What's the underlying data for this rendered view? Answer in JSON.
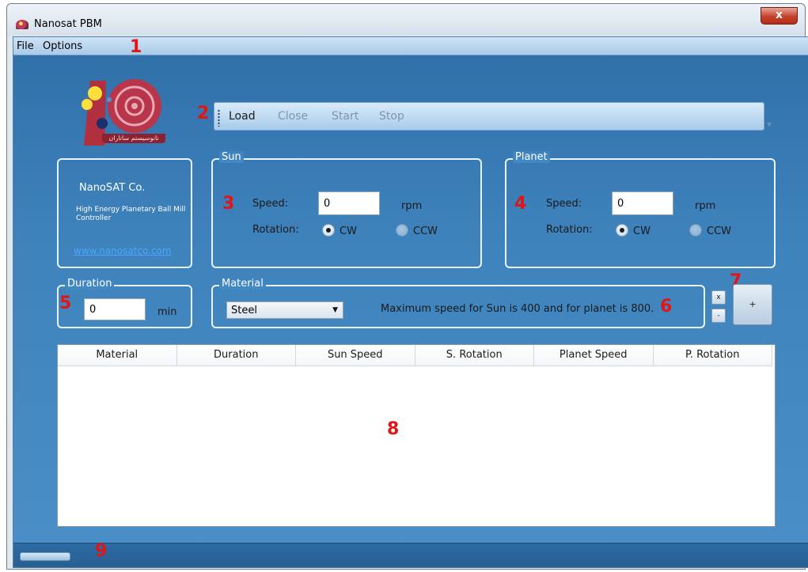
{
  "window": {
    "title": "Nanosat PBM",
    "close_label": "x"
  },
  "menu": {
    "file": "File",
    "options": "Options"
  },
  "markers": [
    "1",
    "2",
    "3",
    "4",
    "5",
    "6",
    "7",
    "8",
    "9"
  ],
  "logo": {
    "caption": "نانوسیستم ساتاران"
  },
  "toolbar": {
    "load": "Load",
    "close": "Close",
    "start": "Start",
    "stop": "Stop"
  },
  "info": {
    "company": "NanoSAT Co.",
    "description": "High Energy Planetary Ball Mill Controller",
    "link": "www.nanosatco.com"
  },
  "sun": {
    "title": "Sun",
    "speed_label": "Speed:",
    "speed_value": "0",
    "unit": "rpm",
    "rotation_label": "Rotation:",
    "cw": "CW",
    "ccw": "CCW",
    "selected": "CW"
  },
  "planet": {
    "title": "Planet",
    "speed_label": "Speed:",
    "speed_value": "0",
    "unit": "rpm",
    "rotation_label": "Rotation:",
    "cw": "CW",
    "ccw": "CCW",
    "selected": "CW"
  },
  "duration": {
    "title": "Duration",
    "value": "0",
    "unit": "min"
  },
  "material": {
    "title": "Material",
    "selected": "Steel",
    "note": "Maximum speed for Sun is 400 and for planet is 800."
  },
  "buttons": {
    "remove": "x",
    "minus": "-",
    "add": "+"
  },
  "table": {
    "columns": [
      "Material",
      "Duration",
      "Sun Speed",
      "S. Rotation",
      "Planet Speed",
      "P. Rotation"
    ],
    "rows": []
  },
  "colors": {
    "accent": "#3f83bd",
    "marker": "#e31414"
  },
  "icons": {
    "app": "app-logo-icon",
    "close": "close-icon",
    "dropdown": "chevron-down-icon"
  }
}
